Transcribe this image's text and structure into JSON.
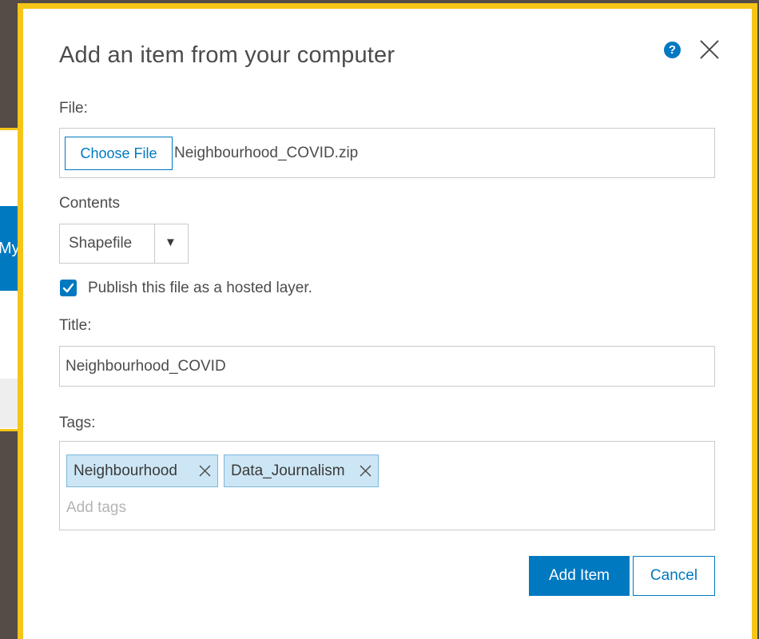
{
  "background": {
    "partial_button_text": "My"
  },
  "dialog": {
    "title": "Add an item from your computer",
    "help_icon_glyph": "?",
    "help_icon": "help-circle-icon",
    "close_icon": "close-icon"
  },
  "file": {
    "label": "File:",
    "choose_button": "Choose File",
    "file_name": "Neighbourhood_COVID.zip"
  },
  "contents": {
    "label": "Contents",
    "selected": "Shapefile",
    "arrow": "▼"
  },
  "publish": {
    "checked": true,
    "label": "Publish this file as a hosted layer."
  },
  "title_field": {
    "label": "Title:",
    "value": "Neighbourhood_COVID"
  },
  "tags": {
    "label": "Tags:",
    "items": [
      {
        "label": "Neighbourhood"
      },
      {
        "label": "Data_Journalism"
      }
    ],
    "placeholder": "Add tags"
  },
  "actions": {
    "add_item": "Add Item",
    "cancel": "Cancel"
  },
  "colors": {
    "accent": "#0079c1",
    "highlight": "#f5c518",
    "tag_bg": "#cde6f5"
  }
}
